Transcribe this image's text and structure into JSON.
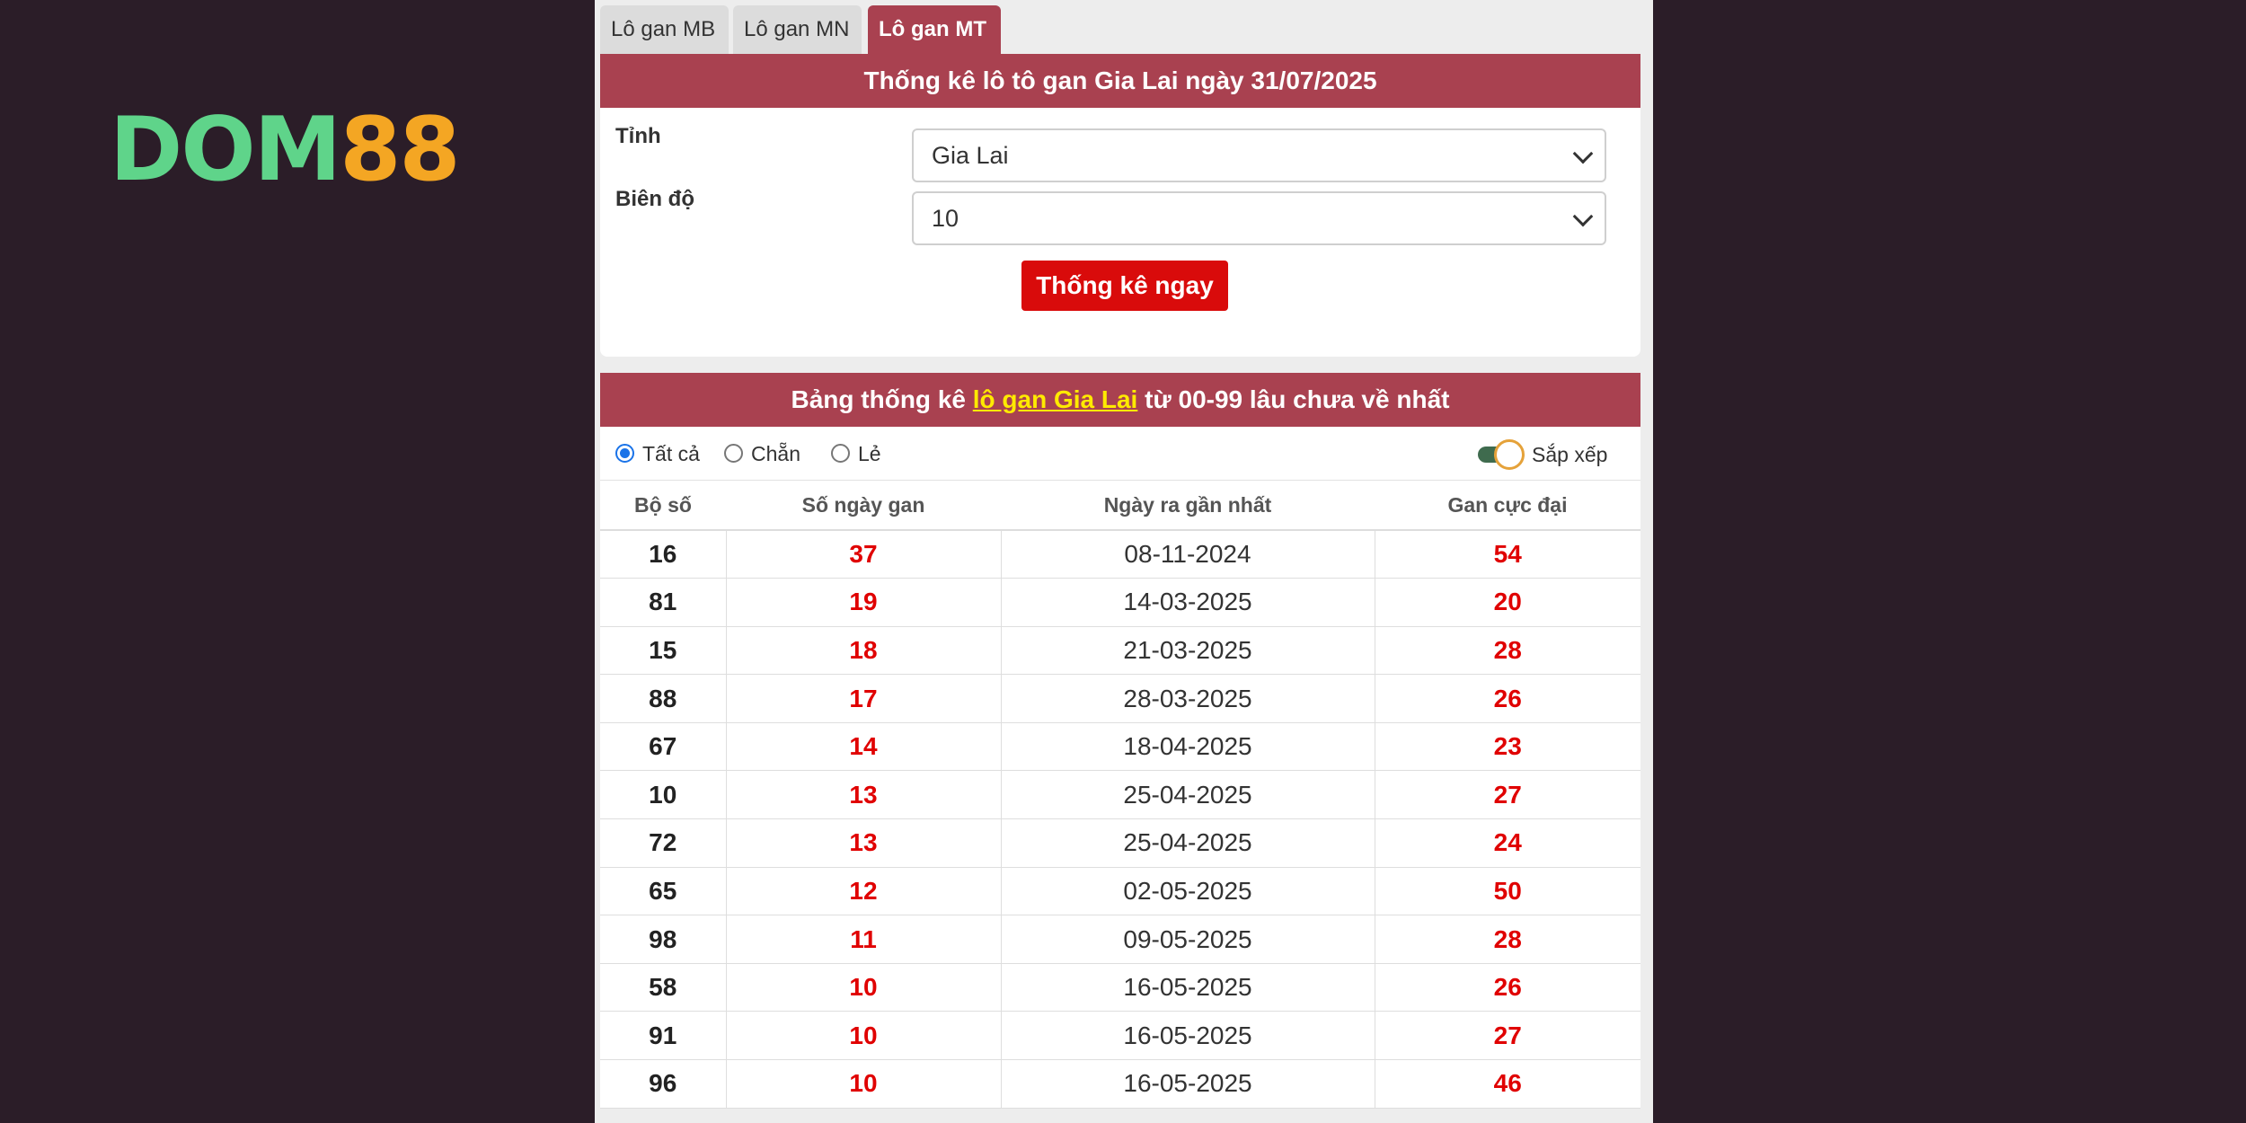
{
  "logo": {
    "part1": "DOM",
    "part2": "88"
  },
  "tabs": [
    {
      "label": "Lô gan MB"
    },
    {
      "label": "Lô gan MN"
    },
    {
      "label": "Lô gan MT"
    }
  ],
  "form": {
    "title": "Thống kê lô tô gan Gia Lai ngày 31/07/2025",
    "province_label": "Tỉnh",
    "province_value": "Gia Lai",
    "range_label": "Biên độ",
    "range_value": "10",
    "submit_label": "Thống kê ngay"
  },
  "results": {
    "title_prefix": "Bảng thống kê",
    "title_link": "lô gan Gia Lai",
    "title_suffix": "từ 00-99 lâu chưa về nhất",
    "filters": [
      {
        "label": "Tất cả",
        "selected": true
      },
      {
        "label": "Chẵn",
        "selected": false
      },
      {
        "label": "Lẻ",
        "selected": false
      }
    ],
    "sort_label": "Sắp xếp",
    "columns": [
      "Bộ số",
      "Số ngày gan",
      "Ngày ra gần nhất",
      "Gan cực đại"
    ],
    "rows": [
      [
        "16",
        "37",
        "08-11-2024",
        "54"
      ],
      [
        "81",
        "19",
        "14-03-2025",
        "20"
      ],
      [
        "15",
        "18",
        "21-03-2025",
        "28"
      ],
      [
        "88",
        "17",
        "28-03-2025",
        "26"
      ],
      [
        "67",
        "14",
        "18-04-2025",
        "23"
      ],
      [
        "10",
        "13",
        "25-04-2025",
        "27"
      ],
      [
        "72",
        "13",
        "25-04-2025",
        "24"
      ],
      [
        "65",
        "12",
        "02-05-2025",
        "50"
      ],
      [
        "98",
        "11",
        "09-05-2025",
        "28"
      ],
      [
        "58",
        "10",
        "16-05-2025",
        "26"
      ],
      [
        "91",
        "10",
        "16-05-2025",
        "27"
      ],
      [
        "96",
        "10",
        "16-05-2025",
        "46"
      ]
    ]
  },
  "colors": {
    "background": "#2b1d28",
    "header": "#a94150",
    "button": "#d90b0b",
    "highlight": "#ffea00",
    "value_red": "#e00000"
  }
}
